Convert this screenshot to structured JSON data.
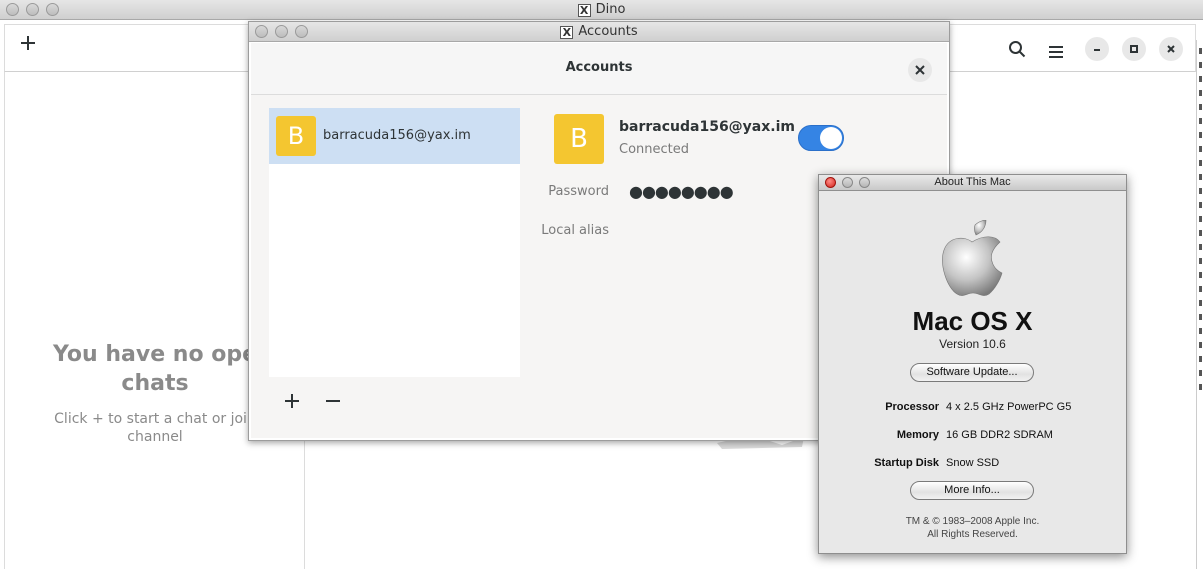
{
  "dino": {
    "window_title": "Dino",
    "empty_title_line1": "You have no ope",
    "empty_title_line2": "chats",
    "empty_sub_line1": "Click + to start a chat or join",
    "empty_sub_line2": "channel",
    "icons": [
      "plus-icon",
      "search-icon",
      "menu-icon",
      "minimize-icon",
      "maximize-icon",
      "close-icon"
    ]
  },
  "accounts": {
    "window_title": "Accounts",
    "header_title": "Accounts",
    "account_avatar_letter": "B",
    "account_list_label": "barracuda156@yax.im",
    "detail_jid": "barracuda156@yax.im",
    "status": "Connected",
    "enabled": true,
    "password_label": "Password",
    "password_value": "●●●●●●●●",
    "alias_label": "Local alias"
  },
  "about": {
    "window_title": "About This Mac",
    "os_name": "Mac OS X",
    "version": "Version 10.6",
    "software_update": "Software Update...",
    "specs": [
      {
        "key": "Processor",
        "value": "4 x 2.5 GHz PowerPC G5"
      },
      {
        "key": "Memory",
        "value": "16 GB DDR2 SDRAM"
      },
      {
        "key": "Startup Disk",
        "value": "Snow SSD"
      }
    ],
    "more_info": "More Info...",
    "copyright": "TM & © 1983–2008 Apple Inc.",
    "rights": "All Rights Reserved."
  },
  "colors": {
    "accent": "#3584e4",
    "avatar": "#f4c630",
    "selected_row": "#cddff3"
  }
}
